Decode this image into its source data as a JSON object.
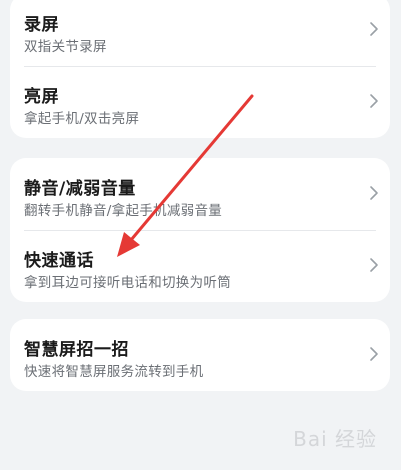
{
  "cards": [
    {
      "items": [
        {
          "title": "录屏",
          "subtitle": "双指关节录屏"
        },
        {
          "title": "亮屏",
          "subtitle": "拿起手机/双击亮屏"
        }
      ]
    },
    {
      "items": [
        {
          "title": "静音/减弱音量",
          "subtitle": "翻转手机静音/拿起手机减弱音量"
        },
        {
          "title": "快速通话",
          "subtitle": "拿到耳边可接听电话和切换为听筒"
        }
      ]
    },
    {
      "items": [
        {
          "title": "智慧屏招一招",
          "subtitle": "快速将智慧屏服务流转到手机"
        }
      ]
    }
  ],
  "watermark": "Bai 经验",
  "colors": {
    "annotation_arrow": "#e53935"
  }
}
